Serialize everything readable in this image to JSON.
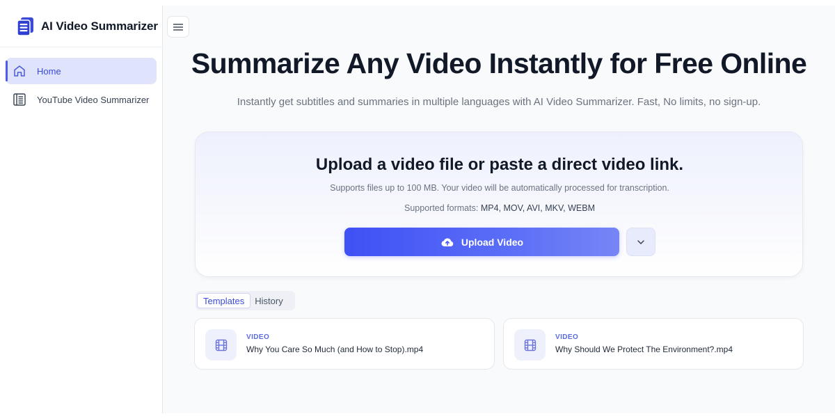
{
  "sidebar": {
    "brand": "AI Video Summarizer",
    "items": [
      {
        "label": "Home",
        "icon": "home-icon",
        "active": true
      },
      {
        "label": "YouTube Video Summarizer",
        "icon": "document-icon",
        "active": false
      }
    ]
  },
  "hero": {
    "title": "Summarize Any Video Instantly for Free Online",
    "subtitle": "Instantly get subtitles and summaries in multiple languages with AI Video Summarizer. Fast, No limits, no sign-up."
  },
  "upload": {
    "title": "Upload a video file or paste a direct video link.",
    "note": "Supports files up to 100 MB. Your video will be automatically processed for transcription.",
    "formats_label": "Supported formats:",
    "formats_value": "MP4, MOV, AVI, MKV, WEBM",
    "button_label": "Upload Video"
  },
  "tabs": [
    {
      "label": "Templates",
      "active": true
    },
    {
      "label": "History",
      "active": false
    }
  ],
  "templates": [
    {
      "kind": "VIDEO",
      "name": "Why You Care So Much (and How to Stop).mp4"
    },
    {
      "kind": "VIDEO",
      "name": "Why Should We Protect The Environment?.mp4"
    }
  ],
  "colors": {
    "accent": "#3f51f5",
    "accent_light": "#dfe3fb",
    "text": "#111827",
    "muted": "#6b7280"
  }
}
